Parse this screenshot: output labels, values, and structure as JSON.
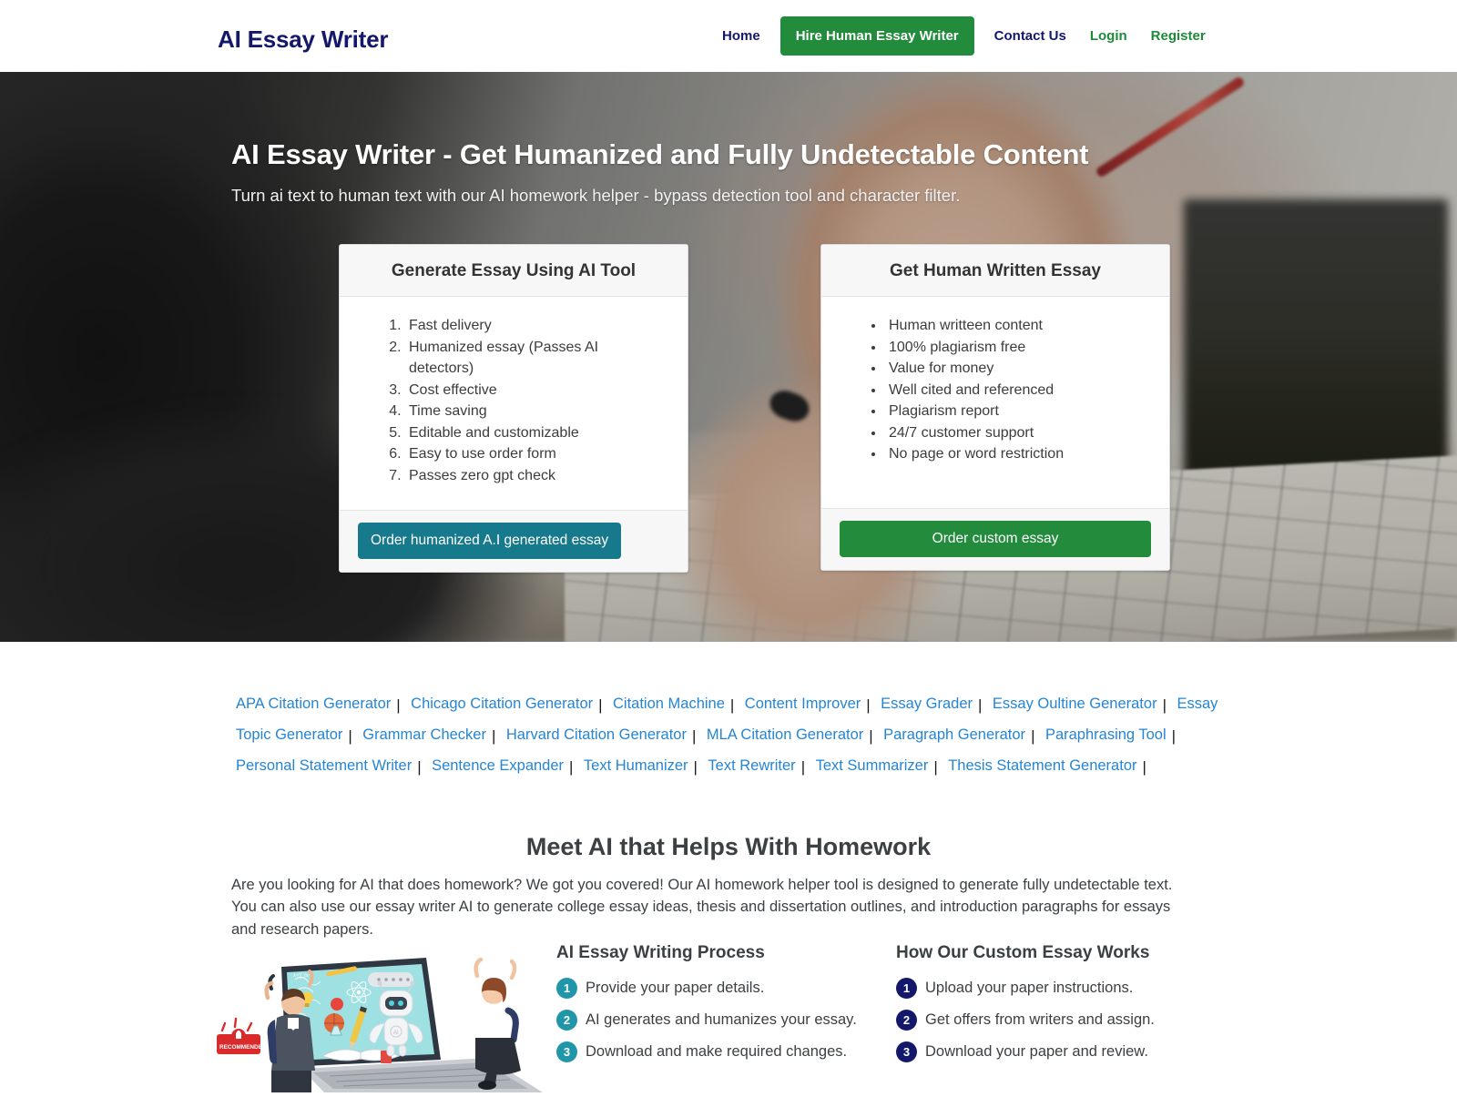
{
  "header": {
    "logo": "AI Essay Writer",
    "nav": [
      {
        "label": "Home",
        "style": "navy"
      },
      {
        "label": "Hire Human Essay Writer",
        "style": "cta"
      },
      {
        "label": "Contact Us",
        "style": "navy"
      },
      {
        "label": "Login",
        "style": "green"
      },
      {
        "label": "Register",
        "style": "green"
      }
    ]
  },
  "hero": {
    "title": "AI Essay Writer - Get Humanized and Fully Undetectable Content",
    "subtitle": "Turn ai text to human text with our AI homework helper - bypass detection tool and character filter.",
    "cards": [
      {
        "title": "Generate Essay Using AI Tool",
        "list_type": "ordered",
        "items": [
          "Fast delivery",
          "Humanized essay (Passes AI detectors)",
          "Cost effective",
          "Time saving",
          "Editable and customizable",
          "Easy to use order form",
          "Passes zero gpt check"
        ],
        "button": "Order humanized A.I generated essay"
      },
      {
        "title": "Get Human Written Essay",
        "list_type": "unordered",
        "items": [
          "Human writteen content",
          "100% plagiarism free",
          "Value for money",
          "Well cited and referenced",
          "Plagiarism report",
          "24/7 customer support",
          "No page or word restriction"
        ],
        "button": "Order custom essay"
      }
    ]
  },
  "tool_links": [
    "APA Citation Generator",
    "Chicago Citation Generator",
    "Citation Machine",
    "Content Improver",
    "Essay Grader",
    "Essay Oultine Generator",
    "Essay Topic Generator",
    "Grammar Checker",
    "Harvard Citation Generator",
    "MLA Citation Generator",
    "Paragraph Generator",
    "Paraphrasing Tool",
    "Personal Statement Writer",
    "Sentence Expander",
    "Text Humanizer",
    "Text Rewriter",
    "Text Summarizer",
    "Thesis Statement Generator"
  ],
  "meet": {
    "title": "Meet AI that Helps With Homework",
    "paragraph": "Are you looking for AI that does homework? We got you covered! Our AI homework helper tool is designed to generate fully undetectable text. You can also use our essay writer AI to generate college essay ideas, thesis and dissertation outlines, and introduction paragraphs for essays and research papers."
  },
  "illustration": {
    "badge_label": "RECOMMENDED"
  },
  "process": {
    "ai": {
      "title": "AI Essay Writing Process",
      "steps": [
        {
          "num": "1",
          "text": "Provide your paper details."
        },
        {
          "num": "2",
          "text": "AI generates and humanizes your essay."
        },
        {
          "num": "3",
          "text": "Download and make required changes."
        }
      ]
    },
    "custom": {
      "title": "How Our Custom Essay Works",
      "steps": [
        {
          "num": "1",
          "text": "Upload your paper instructions."
        },
        {
          "num": "2",
          "text": "Get offers from writers and assign."
        },
        {
          "num": "3",
          "text": "Download your paper and review."
        }
      ]
    }
  },
  "colors": {
    "brand_navy": "#14186b",
    "brand_green": "#228b3c",
    "teal": "#17798c",
    "link_blue": "#2585d3",
    "badge_teal": "#2196a8"
  }
}
